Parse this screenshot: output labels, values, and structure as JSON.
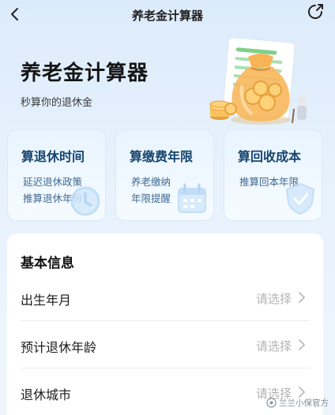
{
  "nav": {
    "title": "养老金计算器",
    "back_icon": "chevron-left-icon",
    "share_icon": "share-arrow-icon"
  },
  "hero": {
    "title": "养老金计算器",
    "subtitle": "秒算你的退休金",
    "illustration": "money-bag-coins-illustration"
  },
  "cards": [
    {
      "title": "算退休时间",
      "lines": [
        "延迟退休政策",
        "推算退休年份"
      ],
      "icon": "clock-icon"
    },
    {
      "title": "算缴费年限",
      "lines": [
        "养老缴纳",
        "年限提醒"
      ],
      "icon": "calendar-icon"
    },
    {
      "title": "算回收成本",
      "lines": [
        "推算回本年限"
      ],
      "icon": "shield-icon"
    }
  ],
  "panel": {
    "title": "基本信息",
    "rows": [
      {
        "label": "出生年月",
        "placeholder": "请选择"
      },
      {
        "label": "预计退休年龄",
        "placeholder": "请选择"
      },
      {
        "label": "退休城市",
        "placeholder": "请选择"
      }
    ]
  },
  "watermark": {
    "text": "兰兰小保官方"
  },
  "colors": {
    "card_title": "#14446e",
    "card_text": "#416a92",
    "placeholder": "#b3b3b3",
    "background_top": "#dcebfb"
  }
}
